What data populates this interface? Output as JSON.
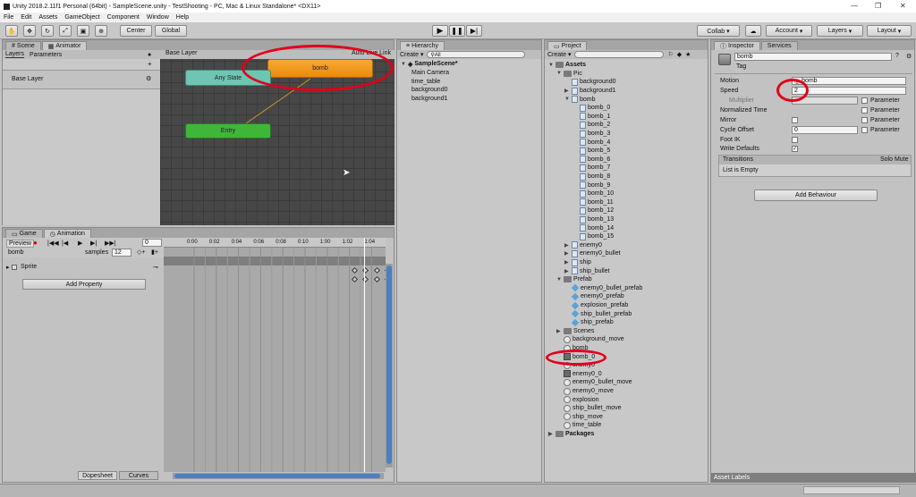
{
  "window": {
    "title": "Unity 2018.2.11f1 Personal (64bit) - SampleScene.unity - TestShooting - PC, Mac & Linux Standalone* <DX11>"
  },
  "menu": [
    "File",
    "Edit",
    "Assets",
    "GameObject",
    "Component",
    "Window",
    "Help"
  ],
  "toolbar": {
    "center_label": "Center",
    "global_label": "Global",
    "collab_label": "Collab ▾",
    "account_label": "Account",
    "layers_label": "Layers",
    "layout_label": "Layout"
  },
  "animator": {
    "tabs": {
      "scene": "Scene",
      "animator": "Animator"
    },
    "subtabs": {
      "layers": "Layers",
      "parameters": "Parameters"
    },
    "base_layer": "Base Layer",
    "breadcrumb": "Base Layer",
    "auto_live_link": "Auto Live Link",
    "nodes": {
      "bomb": "bomb",
      "any_state": "Any State",
      "entry": "Entry"
    }
  },
  "animation": {
    "tabs": {
      "game": "Game",
      "animation": "Animation"
    },
    "preview_label": "Preview",
    "clip_name": "bomb",
    "samples_label": "samples",
    "samples_value": "12",
    "frame_value": "0",
    "timeline_ticks": [
      "0:00",
      "0:02",
      "0:04",
      "0:06",
      "0:08",
      "0:10",
      "1:00",
      "1:02",
      "1:04"
    ],
    "property": "Sprite",
    "add_property_label": "Add Property",
    "dopesheet_label": "Dopesheet",
    "curves_label": "Curves"
  },
  "hierarchy": {
    "tab": "Hierarchy",
    "create_label": "Create ▾",
    "search_placeholder": "All",
    "scene_name": "SampleScene*",
    "items": [
      "Main Camera",
      "time_table",
      "background0",
      "background1"
    ]
  },
  "project": {
    "tab": "Project",
    "create_label": "Create ▾",
    "tree": [
      {
        "label": "Assets",
        "depth": 0,
        "icon": "folder",
        "open": true,
        "bold": true
      },
      {
        "label": "Pic",
        "depth": 1,
        "icon": "folder",
        "open": true
      },
      {
        "label": "background0",
        "depth": 2,
        "icon": "file"
      },
      {
        "label": "background1",
        "depth": 2,
        "icon": "file",
        "closed": true
      },
      {
        "label": "bomb",
        "depth": 2,
        "icon": "file",
        "open": true
      },
      {
        "label": "bomb_0",
        "depth": 3,
        "icon": "file"
      },
      {
        "label": "bomb_1",
        "depth": 3,
        "icon": "file"
      },
      {
        "label": "bomb_2",
        "depth": 3,
        "icon": "file"
      },
      {
        "label": "bomb_3",
        "depth": 3,
        "icon": "file"
      },
      {
        "label": "bomb_4",
        "depth": 3,
        "icon": "file"
      },
      {
        "label": "bomb_5",
        "depth": 3,
        "icon": "file"
      },
      {
        "label": "bomb_6",
        "depth": 3,
        "icon": "file"
      },
      {
        "label": "bomb_7",
        "depth": 3,
        "icon": "file"
      },
      {
        "label": "bomb_8",
        "depth": 3,
        "icon": "file"
      },
      {
        "label": "bomb_9",
        "depth": 3,
        "icon": "file"
      },
      {
        "label": "bomb_10",
        "depth": 3,
        "icon": "file"
      },
      {
        "label": "bomb_11",
        "depth": 3,
        "icon": "file"
      },
      {
        "label": "bomb_12",
        "depth": 3,
        "icon": "file"
      },
      {
        "label": "bomb_13",
        "depth": 3,
        "icon": "file"
      },
      {
        "label": "bomb_14",
        "depth": 3,
        "icon": "file"
      },
      {
        "label": "bomb_15",
        "depth": 3,
        "icon": "file"
      },
      {
        "label": "enemy0",
        "depth": 2,
        "icon": "file",
        "closed": true
      },
      {
        "label": "enemy0_bullet",
        "depth": 2,
        "icon": "file",
        "closed": true
      },
      {
        "label": "ship",
        "depth": 2,
        "icon": "file",
        "closed": true
      },
      {
        "label": "ship_bullet",
        "depth": 2,
        "icon": "file",
        "closed": true
      },
      {
        "label": "Prefab",
        "depth": 1,
        "icon": "folder",
        "open": true
      },
      {
        "label": "enemy0_bullet_prefab",
        "depth": 2,
        "icon": "prefab"
      },
      {
        "label": "enemy0_prefab",
        "depth": 2,
        "icon": "prefab"
      },
      {
        "label": "explosion_prefab",
        "depth": 2,
        "icon": "prefab"
      },
      {
        "label": "ship_bullet_prefab",
        "depth": 2,
        "icon": "prefab"
      },
      {
        "label": "ship_prefab",
        "depth": 2,
        "icon": "prefab"
      },
      {
        "label": "Scenes",
        "depth": 1,
        "icon": "folder",
        "closed": true
      },
      {
        "label": "background_move",
        "depth": 1,
        "icon": "anim"
      },
      {
        "label": "bomb",
        "depth": 1,
        "icon": "anim"
      },
      {
        "label": "bomb_0",
        "depth": 1,
        "icon": "ctrl"
      },
      {
        "label": "enemy0",
        "depth": 1,
        "icon": "anim"
      },
      {
        "label": "enemy0_0",
        "depth": 1,
        "icon": "ctrl"
      },
      {
        "label": "enemy0_bullet_move",
        "depth": 1,
        "icon": "anim"
      },
      {
        "label": "enemy0_move",
        "depth": 1,
        "icon": "anim"
      },
      {
        "label": "explosion",
        "depth": 1,
        "icon": "anim"
      },
      {
        "label": "ship_bullet_move",
        "depth": 1,
        "icon": "anim"
      },
      {
        "label": "ship_move",
        "depth": 1,
        "icon": "anim"
      },
      {
        "label": "time_table",
        "depth": 1,
        "icon": "anim"
      },
      {
        "label": "Packages",
        "depth": 0,
        "icon": "folder",
        "closed": true,
        "bold": true
      }
    ]
  },
  "inspector": {
    "tabs": {
      "inspector": "Inspector",
      "services": "Services"
    },
    "name_value": "bomb",
    "tag_label": "Tag",
    "motion_label": "Motion",
    "motion_value": "bomb",
    "speed_label": "Speed",
    "speed_value": "2",
    "multiplier_label": "Multiplier",
    "normalized_time_label": "Normalized Time",
    "mirror_label": "Mirror",
    "cycle_offset_label": "Cycle Offset",
    "cycle_offset_value": "0",
    "foot_ik_label": "Foot IK",
    "write_defaults_label": "Write Defaults",
    "parameter_label": "Parameter",
    "transitions_label": "Transitions",
    "solo_mute_label": "Solo Mute",
    "list_empty": "List is Empty",
    "add_behaviour_label": "Add Behaviour",
    "asset_labels": "Asset Labels"
  }
}
